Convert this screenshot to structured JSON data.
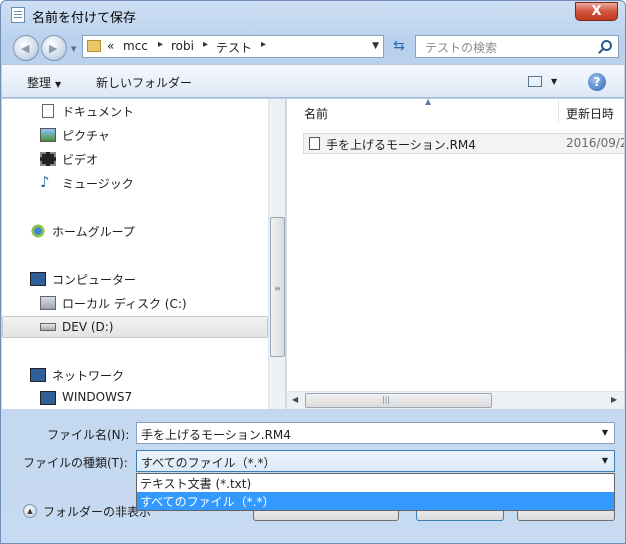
{
  "window": {
    "title": "名前を付けて保存",
    "close_label": "X"
  },
  "nav": {
    "breadcrumbs": [
      "mcc",
      "robi",
      "テスト"
    ],
    "breadcrumb_prefix": "«",
    "search_placeholder": "テストの検索"
  },
  "toolbar": {
    "organize_label": "整理",
    "new_folder_label": "新しいフォルダー"
  },
  "sidebar": {
    "libraries": [
      {
        "label": "ドキュメント",
        "icon": "document-icon"
      },
      {
        "label": "ピクチャ",
        "icon": "pictures-icon"
      },
      {
        "label": "ビデオ",
        "icon": "video-icon"
      },
      {
        "label": "ミュージック",
        "icon": "music-icon"
      }
    ],
    "homegroup": "ホームグループ",
    "computer": "コンピューター",
    "drives": [
      "ローカル ディスク (C:)",
      "DEV (D:)"
    ],
    "network": "ネットワーク",
    "network_items": [
      "WINDOWS7"
    ]
  },
  "file_list": {
    "columns": {
      "name": "名前",
      "date": "更新日時"
    },
    "files": [
      {
        "name": "手を上げるモーション.RM4",
        "date": "2016/09/2"
      }
    ]
  },
  "form": {
    "filename_label": "ファイル名(N):",
    "filename_value": "手を上げるモーション.RM4",
    "filetype_label": "ファイルの種類(T):",
    "filetype_value": "すべてのファイル（*.*）",
    "filetype_options": [
      "テキスト文書 (*.txt)",
      "すべてのファイル（*.*）"
    ],
    "selected_option_index": 1,
    "hide_folders_label": "フォルダーの非表示"
  },
  "colors": {
    "selection": "#3399ff",
    "close_button": "#c23b22"
  }
}
